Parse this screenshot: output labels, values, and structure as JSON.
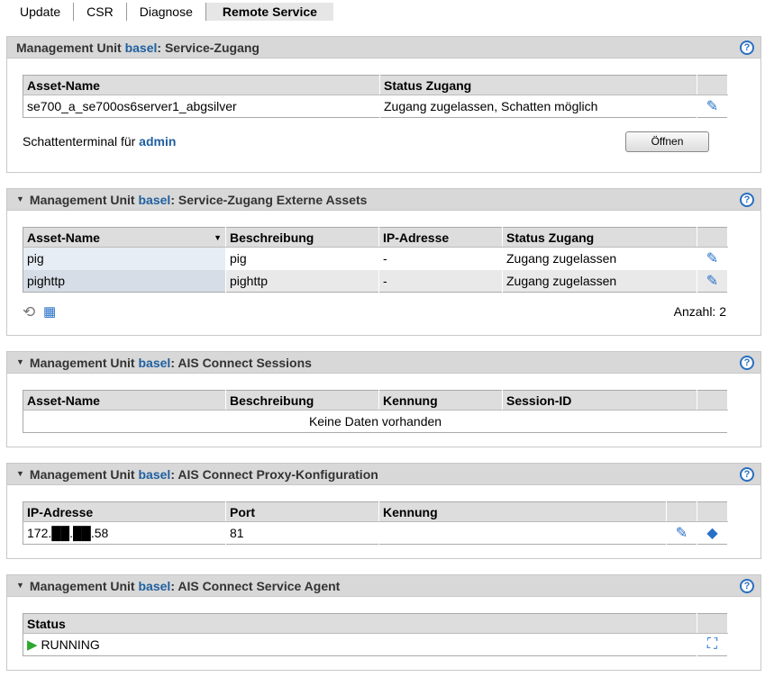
{
  "tabs": [
    "Update",
    "CSR",
    "Diagnose",
    "Remote Service"
  ],
  "mu_prefix": "Management Unit ",
  "mu_name": "basel",
  "help": "?",
  "p1": {
    "title": ": Service-Zugang",
    "cols": [
      "Asset-Name",
      "Status Zugang"
    ],
    "rows": [
      [
        "se700_a_se700os6server1_abgsilver",
        "Zugang zugelassen, Schatten möglich"
      ]
    ],
    "shadow_label": "Schattenterminal für ",
    "shadow_user": "admin",
    "open_btn": "Öffnen"
  },
  "p2": {
    "title": ": Service-Zugang Externe Assets",
    "cols": [
      "Asset-Name",
      "Beschreibung",
      "IP-Adresse",
      "Status Zugang"
    ],
    "rows": [
      [
        "pig",
        "pig",
        "-",
        "Zugang zugelassen"
      ],
      [
        "pighttp",
        "pighttp",
        "-",
        "Zugang zugelassen"
      ]
    ],
    "count": "Anzahl: 2"
  },
  "p3": {
    "title": ": AIS Connect Sessions",
    "cols": [
      "Asset-Name",
      "Beschreibung",
      "Kennung",
      "Session-ID"
    ],
    "empty": "Keine Daten vorhanden"
  },
  "p4": {
    "title": ": AIS Connect Proxy-Konfiguration",
    "cols": [
      "IP-Adresse",
      "Port",
      "Kennung"
    ],
    "rows": [
      [
        "172.██.██.58",
        "81",
        ""
      ]
    ]
  },
  "p5": {
    "title": ": AIS Connect Service Agent",
    "cols": [
      "Status"
    ],
    "status": "RUNNING"
  }
}
